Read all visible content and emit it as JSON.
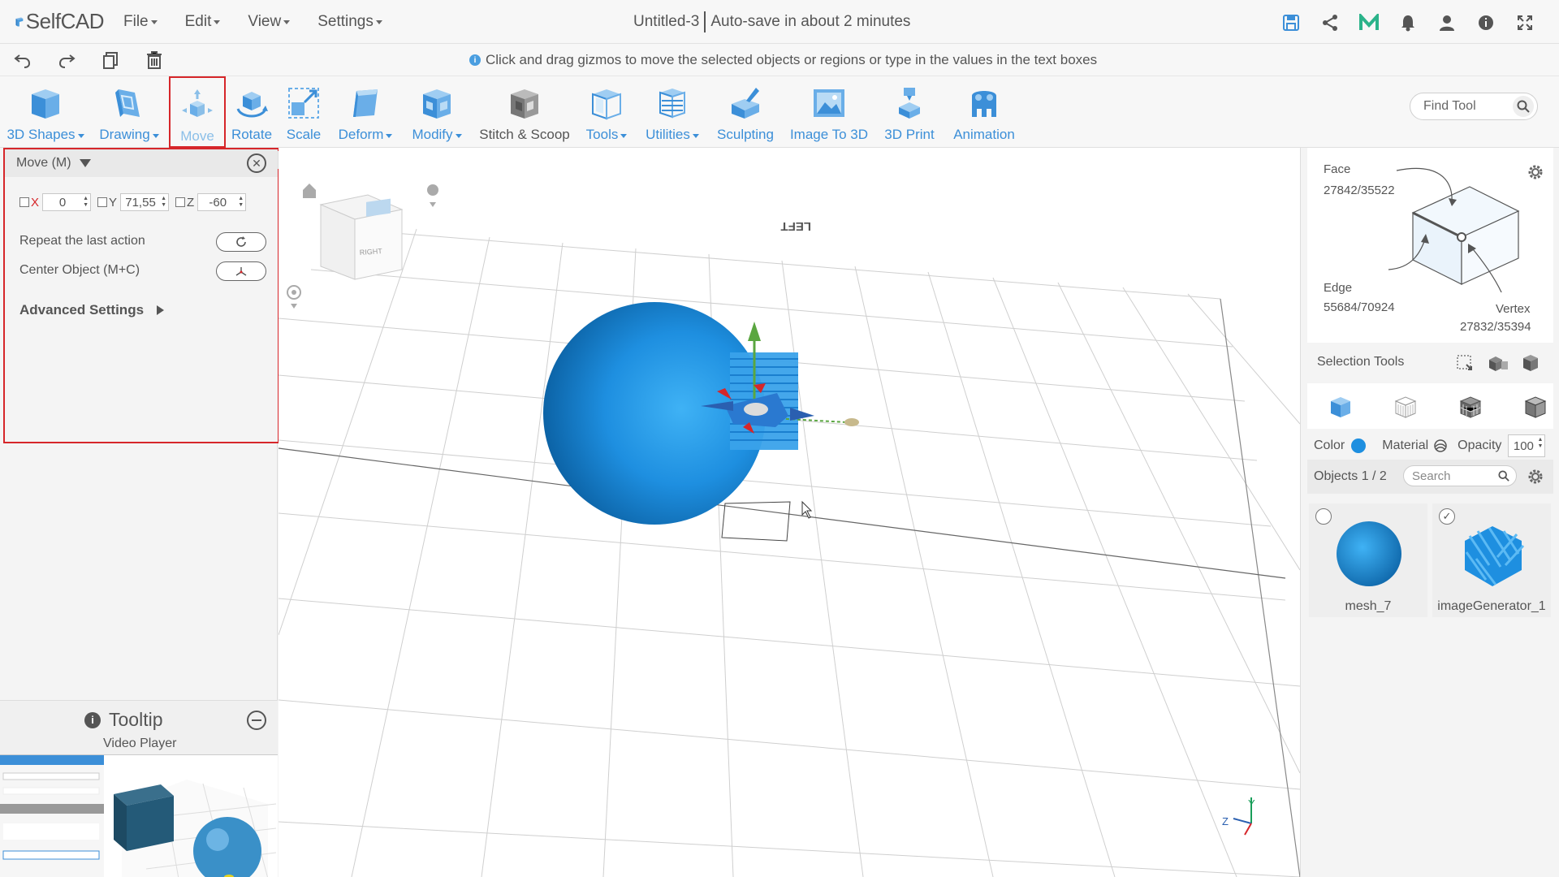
{
  "app": {
    "brand": "SelfCAD",
    "menu": [
      {
        "label": "File"
      },
      {
        "label": "Edit"
      },
      {
        "label": "View"
      },
      {
        "label": "Settings"
      }
    ],
    "doc_title": "Untitled-3",
    "autosave": "Auto-save in about 2 minutes",
    "hint": "Click and drag gizmos to move the selected objects or regions or type in the values in the text boxes"
  },
  "toolbar": {
    "tools": [
      {
        "label": "3D Shapes",
        "dropdown": true
      },
      {
        "label": "Drawing",
        "dropdown": true
      },
      {
        "label": "Move",
        "dropdown": false
      },
      {
        "label": "Rotate",
        "dropdown": false
      },
      {
        "label": "Scale",
        "dropdown": false
      },
      {
        "label": "Deform",
        "dropdown": true
      },
      {
        "label": "Modify",
        "dropdown": true
      },
      {
        "label": "Stitch & Scoop",
        "dropdown": false
      },
      {
        "label": "Tools",
        "dropdown": true
      },
      {
        "label": "Utilities",
        "dropdown": true
      },
      {
        "label": "Sculpting",
        "dropdown": false
      },
      {
        "label": "Image To 3D",
        "dropdown": false
      },
      {
        "label": "3D Print",
        "dropdown": false
      },
      {
        "label": "Animation",
        "dropdown": false
      }
    ],
    "find_tool_placeholder": "Find Tool"
  },
  "move_panel": {
    "title": "Move (M)",
    "x_label": "X",
    "x_value": "0",
    "y_label": "Y",
    "y_value": "71,55",
    "z_label": "Z",
    "z_value": "-60",
    "repeat_label": "Repeat the last action",
    "center_label": "Center Object (M+C)",
    "advanced_label": "Advanced Settings"
  },
  "tooltip": {
    "title": "Tooltip",
    "subtitle": "Video Player"
  },
  "viewport": {
    "view_cube_label": "LEFT",
    "axis_y": "Y",
    "axis_z": "Z"
  },
  "selector": {
    "face_label": "Face",
    "face_count": "27842/35522",
    "edge_label": "Edge",
    "edge_count": "55684/70924",
    "vertex_label": "Vertex",
    "vertex_count": "27832/35394",
    "selection_tools": "Selection Tools"
  },
  "properties": {
    "color_label": "Color",
    "material_label": "Material",
    "opacity_label": "Opacity",
    "opacity_value": "100",
    "accent_color": "#1e8fe0"
  },
  "objects": {
    "label": "Objects 1 / 2",
    "search_placeholder": "Search",
    "items": [
      {
        "name": "mesh_7",
        "selected": false
      },
      {
        "name": "imageGenerator_1",
        "selected": true
      }
    ]
  }
}
